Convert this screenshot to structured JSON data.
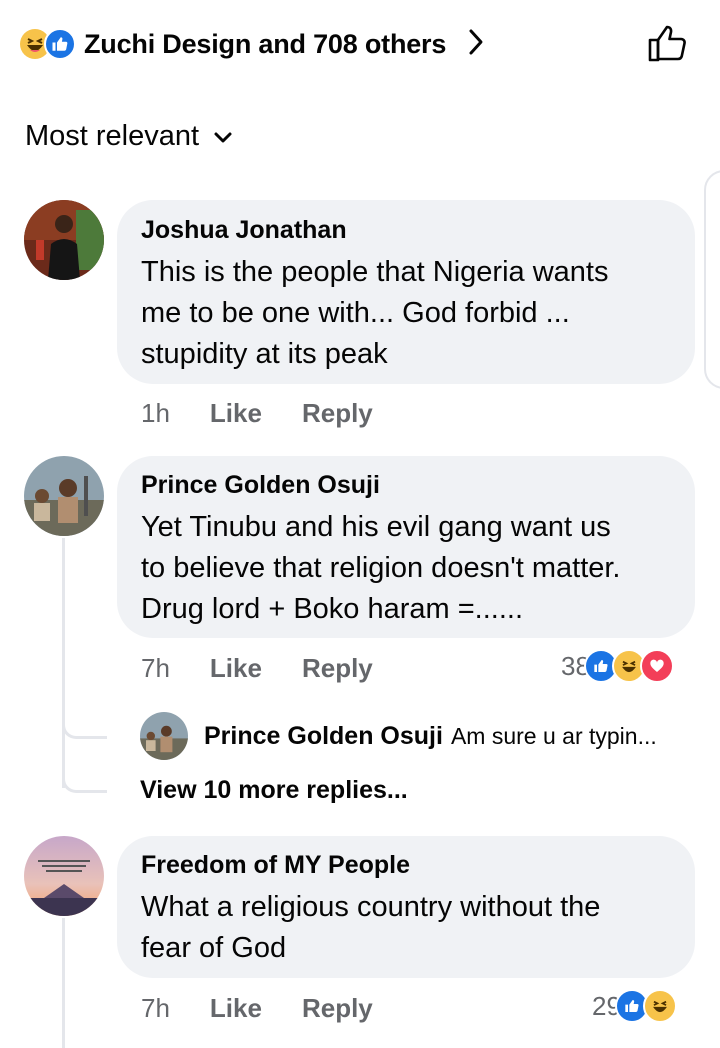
{
  "header": {
    "reactors": "Zuchi Design and 708 others",
    "reaction_icons": [
      "haha-emoji",
      "like-emoji"
    ]
  },
  "sort": {
    "label": "Most relevant"
  },
  "comments": [
    {
      "author": "Joshua Jonathan",
      "text_lines": [
        "This is the people that Nigeria wants",
        "me to be one with... God forbid ...",
        "stupidity at its peak"
      ],
      "time": "1h",
      "like": "Like",
      "reply": "Reply"
    },
    {
      "author": "Prince Golden Osuji",
      "text_lines": [
        "Yet Tinubu and his evil gang want us",
        "to believe that religion doesn't matter.",
        "Drug lord + Boko haram =......"
      ],
      "time": "7h",
      "like": "Like",
      "reply": "Reply",
      "reaction_count": "38",
      "reactions": [
        "like",
        "haha",
        "love"
      ],
      "reply_preview": {
        "author": "Prince Golden Osuji",
        "text": "Am sure u ar typin..."
      },
      "view_more": "View 10 more replies..."
    },
    {
      "author": "Freedom of MY People",
      "text_lines": [
        "What a religious country without the",
        "fear of God"
      ],
      "time": "7h",
      "like": "Like",
      "reply": "Reply",
      "reaction_count": "29",
      "reactions": [
        "like",
        "haha"
      ]
    }
  ],
  "colors": {
    "bubble": "#f0f2f5",
    "secondary_text": "#65676b",
    "like_blue": "#1b74e4",
    "haha_yellow": "#f7c34a",
    "love_red": "#f33e58"
  }
}
